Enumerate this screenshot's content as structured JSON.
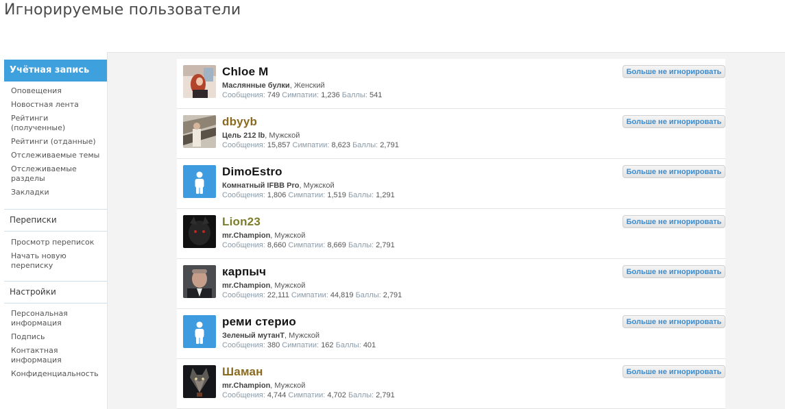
{
  "page": {
    "title": "Игнорируемые пользователи"
  },
  "sidebar": {
    "account_header": "Учётная запись",
    "account_items": [
      "Оповещения",
      "Новостная лента",
      "Рейтинги (полученные)",
      "Рейтинги (отданные)",
      "Отслеживаемые темы",
      "Отслеживаемые разделы",
      "Закладки"
    ],
    "conversations_header": "Переписки",
    "conversations_items": [
      "Просмотр переписок",
      "Начать новую переписку"
    ],
    "settings_header": "Настройки",
    "settings_items": [
      "Персональная информация",
      "Подпись",
      "Контактная информация",
      "Конфиденциальность"
    ]
  },
  "labels": {
    "messages": "Сообщения:",
    "likes": "Симпатии:",
    "points": "Баллы:",
    "unignore": "Больше не игнорировать"
  },
  "colors": {
    "accent": "#3ea0dd",
    "username_gold": "#8a6a1f",
    "username_olive": "#7c7d28",
    "button_text": "#3c8bcc"
  },
  "users": [
    {
      "name": "Chloe M",
      "user_title": "Маслянные булки",
      "gender": "Женский",
      "messages": "749",
      "likes": "1,236",
      "points": "541",
      "avatar": "photo-red-hair"
    },
    {
      "name": "dbyyb",
      "user_title": "Цель 212 lb",
      "gender": "Мужской",
      "messages": "15,857",
      "likes": "8,623",
      "points": "2,791",
      "avatar": "photo-gym"
    },
    {
      "name": "DimoEstro",
      "user_title": "Комнатный IFBB Pro",
      "gender": "Мужской",
      "messages": "1,806",
      "likes": "1,519",
      "points": "1,291",
      "avatar": "default-user-icon"
    },
    {
      "name": "Lion23",
      "user_title": "mr.Champion",
      "gender": "Мужской",
      "messages": "8,660",
      "likes": "8,669",
      "points": "2,791",
      "avatar": "photo-dark-wolf"
    },
    {
      "name": "карпыч",
      "user_title": "mr.Champion",
      "gender": "Мужской",
      "messages": "22,111",
      "likes": "44,819",
      "points": "2,791",
      "avatar": "photo-man-portrait"
    },
    {
      "name": "реми стерио",
      "user_title": "Зеленый мутанТ",
      "gender": "Мужской",
      "messages": "380",
      "likes": "162",
      "points": "401",
      "avatar": "default-user-icon"
    },
    {
      "name": "Шаман",
      "user_title": "mr.Champion",
      "gender": "Мужской",
      "messages": "4,744",
      "likes": "4,702",
      "points": "2,791",
      "avatar": "photo-wolf-art"
    }
  ]
}
